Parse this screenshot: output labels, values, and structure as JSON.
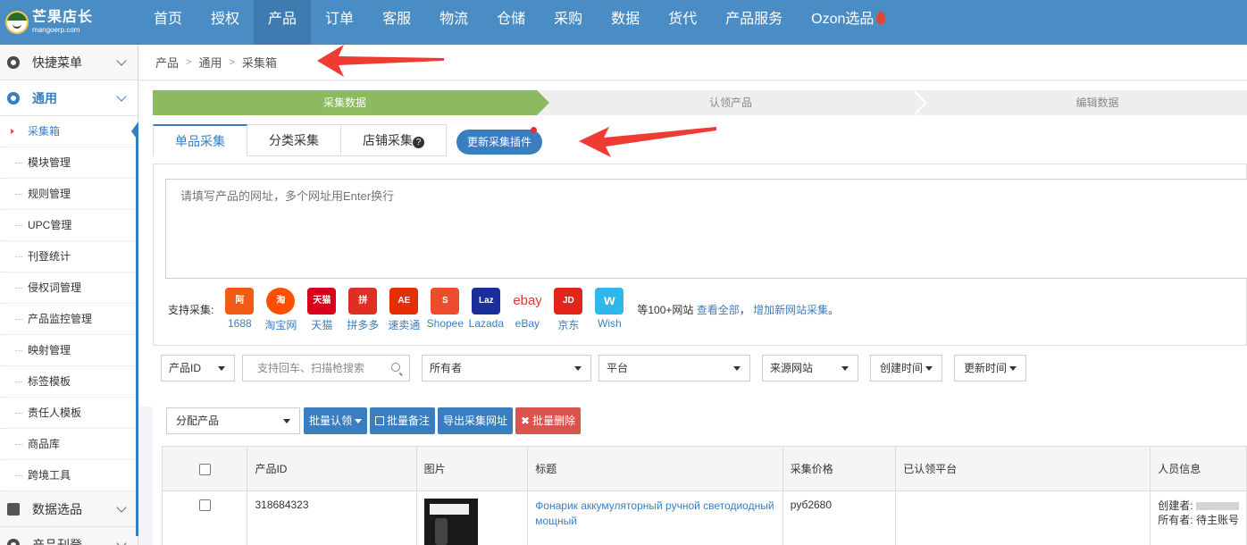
{
  "logo": {
    "name": "芒果店长",
    "domain": "mangoerp.com"
  },
  "nav": {
    "items": [
      "首页",
      "授权",
      "产品",
      "订单",
      "客服",
      "物流",
      "仓储",
      "采购",
      "数据",
      "货代",
      "产品服务",
      "Ozon选品"
    ],
    "active": "产品"
  },
  "sidebar": {
    "quick_menu": "快捷菜单",
    "general": "通用",
    "sub_items": [
      "采集箱",
      "模块管理",
      "规则管理",
      "UPC管理",
      "刊登统计",
      "侵权词管理",
      "产品监控管理",
      "映射管理",
      "标签模板",
      "责任人模板",
      "商品库",
      "跨境工具"
    ],
    "active_sub": "采集箱",
    "data_selection": "数据选品",
    "product_listing": "产品刊登"
  },
  "breadcrumb": [
    "产品",
    "通用",
    "采集箱"
  ],
  "steps": [
    "采集数据",
    "认领产品",
    "编辑数据"
  ],
  "tabs": [
    "单品采集",
    "分类采集",
    "店铺采集"
  ],
  "plugin_button": "更新采集插件",
  "url_input": {
    "placeholder": "请填写产品的网址，多个网址用Enter换行"
  },
  "support": {
    "label": "支持采集:",
    "platforms": [
      {
        "name": "1688",
        "color": "#f25a16",
        "icon": "1688-icon",
        "glyph": "阿"
      },
      {
        "name": "淘宝网",
        "color": "#ff5000",
        "icon": "taobao-icon",
        "glyph": "淘"
      },
      {
        "name": "天猫",
        "color": "#d9001b",
        "icon": "tmall-icon",
        "glyph": "天猫"
      },
      {
        "name": "拼多多",
        "color": "#e02e24",
        "icon": "pinduoduo-icon",
        "glyph": "拼"
      },
      {
        "name": "速卖通",
        "color": "#e62e04",
        "icon": "aliexpress-icon",
        "glyph": "AE"
      },
      {
        "name": "Shopee",
        "color": "#ee4d2d",
        "icon": "shopee-icon",
        "glyph": "S"
      },
      {
        "name": "Lazada",
        "color": "#1b2e9c",
        "icon": "lazada-icon",
        "glyph": "Laz"
      },
      {
        "name": "eBay",
        "color": "#ffffff",
        "icon": "ebay-icon",
        "glyph": "ebay"
      },
      {
        "name": "京东",
        "color": "#e1251b",
        "icon": "jd-icon",
        "glyph": "JD"
      },
      {
        "name": "Wish",
        "color": "#2fb7ec",
        "icon": "wish-icon",
        "glyph": "w"
      }
    ],
    "more_text": "等100+网站",
    "view_all": "查看全部",
    "separator": "，",
    "add_new": "增加新网站采集",
    "period": "。"
  },
  "filters": {
    "product_id": "产品ID",
    "search_placeholder": "支持回车、扫描枪搜索",
    "owner": "所有者",
    "platform": "平台",
    "source": "来源网站",
    "created_time": "创建时间",
    "updated_time": "更新时间"
  },
  "actions": {
    "assign": "分配产品",
    "batch_claim": "批量认领",
    "batch_note": "批量备注",
    "export_urls": "导出采集网址",
    "batch_delete": "批量删除"
  },
  "table": {
    "headers": [
      "产品ID",
      "图片",
      "标题",
      "采集价格",
      "已认领平台",
      "人员信息"
    ],
    "rows": [
      {
        "id": "318684323",
        "title": "Фонарик аккумуляторный ручной светодиодный мощный",
        "price": "руб2680",
        "claimed": "",
        "creator_label": "创建者:",
        "owner_label": "所有者:",
        "owner_value": "待主账号"
      }
    ]
  },
  "colors": {
    "nav": "#4a8cc4",
    "accent": "#3b7ec0",
    "step_active": "#8bbb5e",
    "danger": "#d9534f",
    "arrow": "#ee3b33"
  }
}
